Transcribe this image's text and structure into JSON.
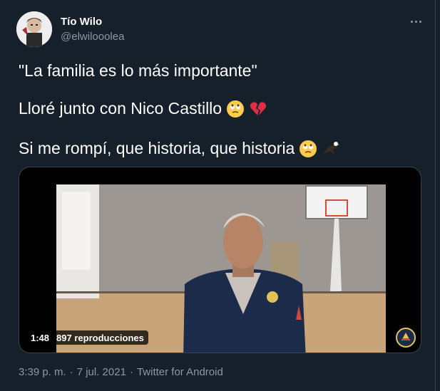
{
  "user": {
    "display_name": "Tío Wilo",
    "handle": "@elwilooolea"
  },
  "tweet": {
    "line1": "\"La familia es lo más importante\"",
    "line2": "Lloré junto con Nico Castillo",
    "line3": "Si me rompí, que historia, que historia",
    "line2_emojis": [
      "rolling-eyes-face",
      "broken-heart"
    ],
    "line3_emojis": [
      "rolling-eyes-face",
      "eagle"
    ]
  },
  "media": {
    "duration": "1:48",
    "views": "897 reproducciones"
  },
  "footer": {
    "time": "3:39 p. m.",
    "sep1": "·",
    "date": "7 jul. 2021",
    "sep2": "·",
    "source": "Twitter for Android"
  },
  "colors": {
    "background": "#15202b",
    "secondary_text": "#8899a6",
    "border": "#38444d"
  }
}
